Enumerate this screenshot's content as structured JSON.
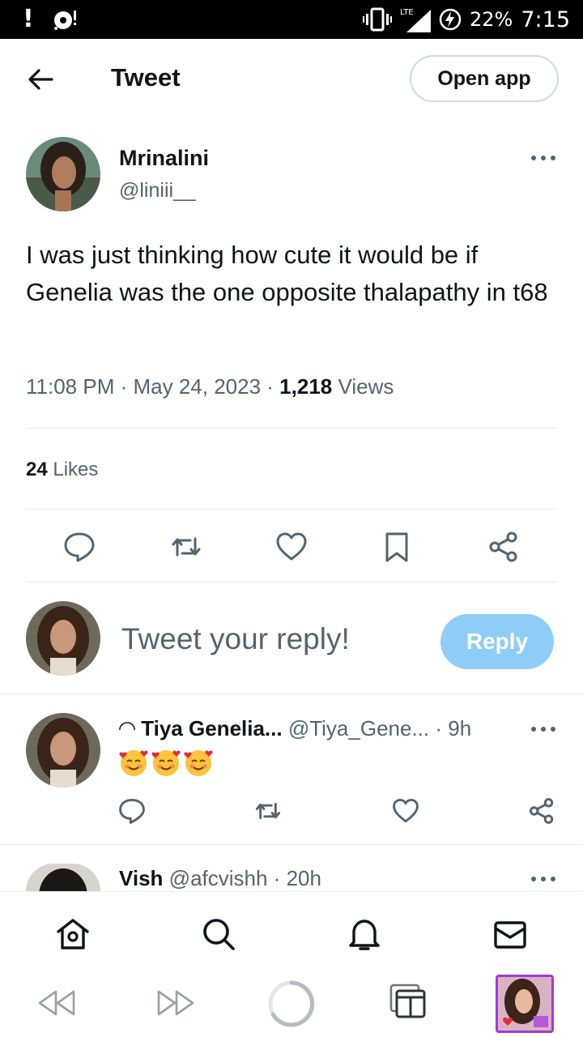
{
  "status_bar": {
    "battery": "22%",
    "time": "7:15",
    "network": "LTE"
  },
  "header": {
    "title": "Tweet",
    "open_app_label": "Open app"
  },
  "tweet": {
    "author_name": "Mrinalini",
    "author_handle": "@liniii__",
    "text": "I was just thinking how cute it would be if Genelia was the one opposite thalapathy in t68",
    "time": "11:08 PM",
    "date": "May 24, 2023",
    "views_count": "1,218",
    "views_label": "Views",
    "likes_count": "24",
    "likes_label": "Likes"
  },
  "composer": {
    "placeholder": "Tweet your reply!",
    "reply_label": "Reply"
  },
  "replies": [
    {
      "name": "◠ Tiya Genelia...",
      "handle": "@Tiya_Gene...",
      "age": "· 9h",
      "emoji_count": 3
    },
    {
      "name": "Vish",
      "handle": "@afcvishh",
      "age": "· 20h"
    }
  ],
  "colors": {
    "accent": "#1d9bf0",
    "reply_button_disabled": "#8ecdf8",
    "secondary_text": "#536471",
    "primary_text": "#0f1419",
    "divider": "#e7eaec"
  },
  "icons": {
    "tweet_actions": [
      "reply-icon",
      "retweet-icon",
      "like-icon",
      "bookmark-icon",
      "share-icon"
    ],
    "tabs": [
      "home-icon",
      "search-icon",
      "notifications-icon",
      "messages-icon"
    ],
    "browser_nav": [
      "back-icon",
      "forward-icon",
      "reload-icon",
      "tabs-icon",
      "profile-thumbnail"
    ]
  }
}
